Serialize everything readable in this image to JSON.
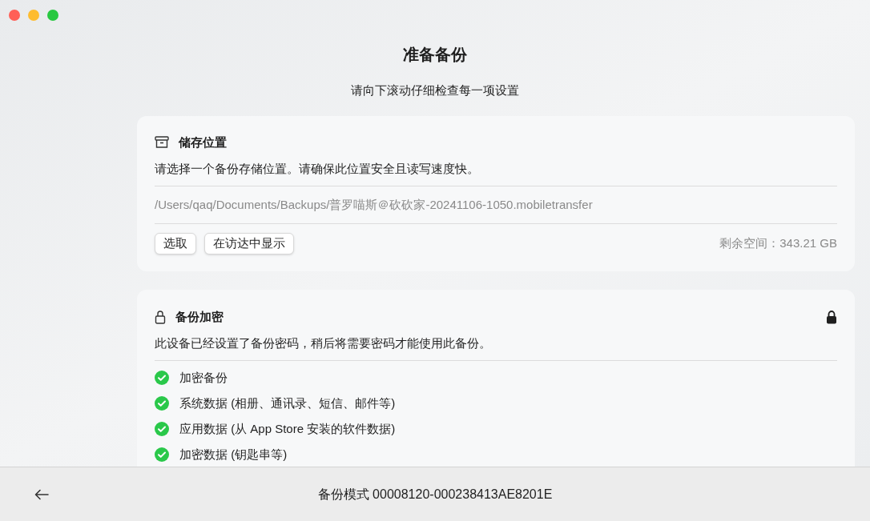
{
  "header": {
    "title": "准备备份",
    "subtitle": "请向下滚动仔细检查每一项设置"
  },
  "storage": {
    "title": "储存位置",
    "description": "请选择一个备份存储位置。请确保此位置安全且读写速度快。",
    "path": "/Users/qaq/Documents/Backups/普罗喵斯＠砍砍家-20241106-1050.mobiletransfer",
    "buttons": [
      "选取",
      "在访达中显示"
    ],
    "free_space": "剩余空间：343.21 GB"
  },
  "encryption": {
    "title": "备份加密",
    "locked": true,
    "description": "此设备已经设置了备份密码，稍后将需要密码才能使用此备份。",
    "items": [
      {
        "label": "加密备份",
        "checked": true
      },
      {
        "label": "系统数据 (相册、通讯录、短信、邮件等)",
        "checked": true
      },
      {
        "label": "应用数据 (从 App Store 安装的软件数据)",
        "checked": true
      },
      {
        "label": "加密数据 (钥匙串等)",
        "checked": true
      }
    ]
  },
  "footer": {
    "mode": "备份模式 00008120-000238413AE8201E"
  }
}
